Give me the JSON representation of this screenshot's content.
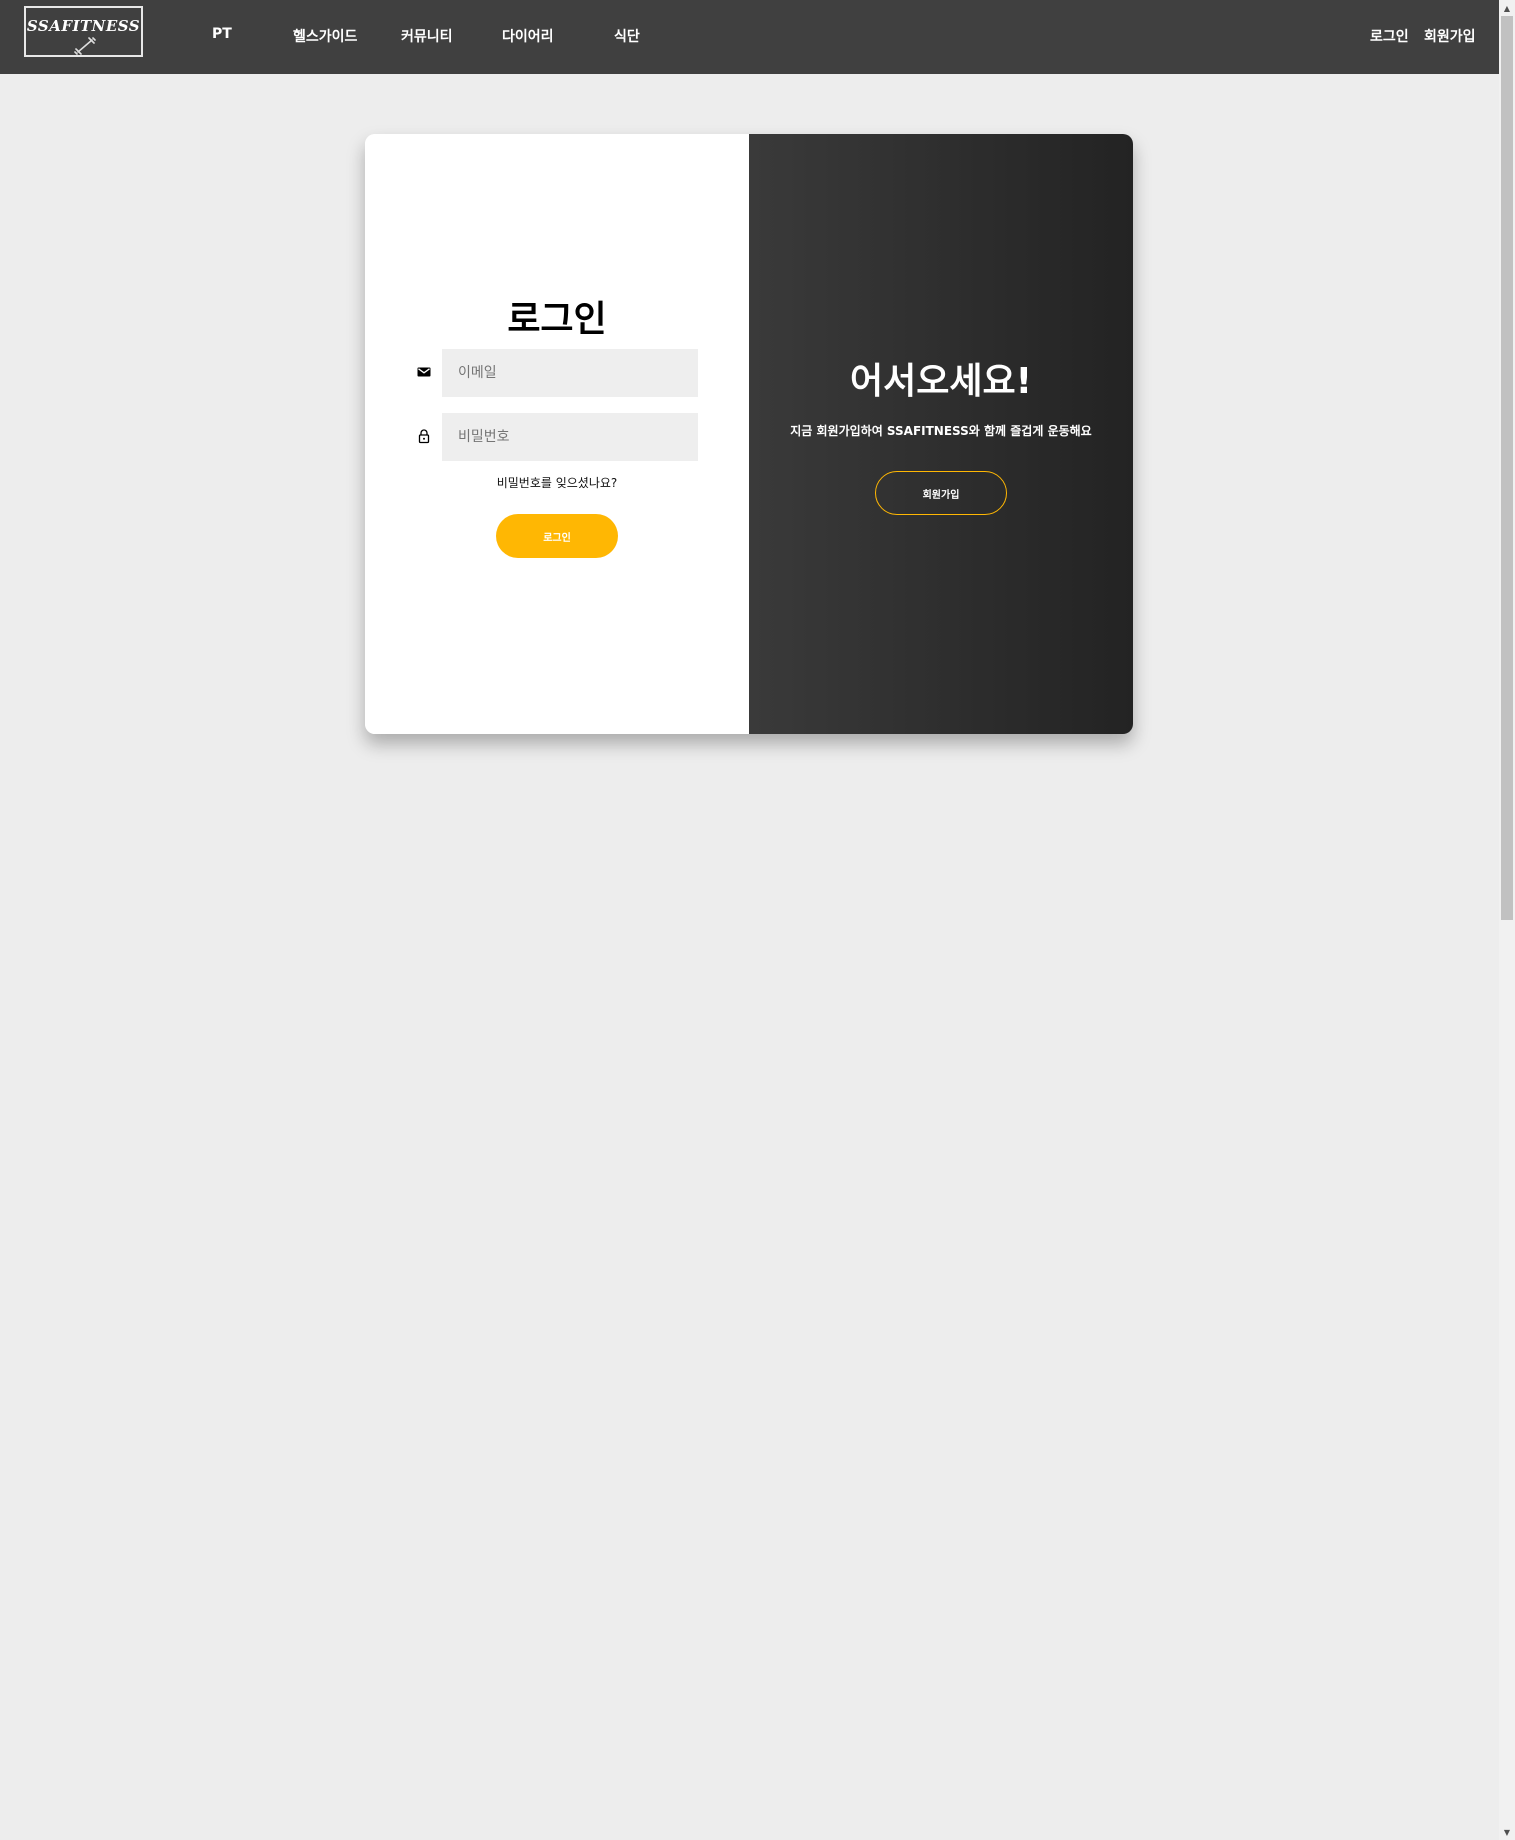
{
  "nav": {
    "logo_text": "SSAFITNESS",
    "links": [
      "PT",
      "헬스가이드",
      "커뮤니티",
      "다이어리",
      "식단"
    ],
    "auth": {
      "login": "로그인",
      "signup": "회원가입"
    }
  },
  "login": {
    "title": "로그인",
    "email_placeholder": "이메일",
    "password_placeholder": "비밀번호",
    "forgot": "비밀번호를 잊으셨나요?",
    "button": "로그인"
  },
  "welcome": {
    "title": "어서오세요!",
    "subtitle": "지금 회원가입하여 SSAFITNESS와 함께 즐겁게 운동해요",
    "button": "회원가입"
  },
  "icons": {
    "email": "mail-icon",
    "password": "lock-icon",
    "logo": "dumbbell-icon"
  },
  "colors": {
    "navbar": "#404040",
    "accent": "#ffb703",
    "page_bg": "#ededed",
    "input_bg": "#eeeeee"
  }
}
